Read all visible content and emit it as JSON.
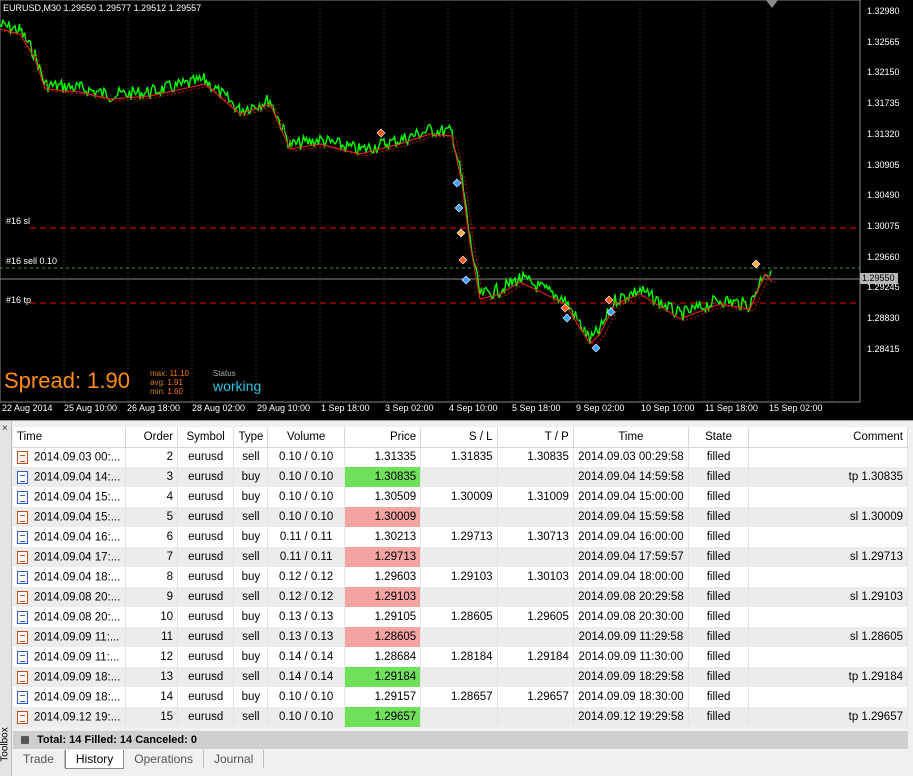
{
  "chart": {
    "title": "EURUSD,M30  1.29550 1.29577 1.29512 1.29557",
    "price_labels": [
      "1.32980",
      "1.32565",
      "1.32150",
      "1.31735",
      "1.31320",
      "1.30905",
      "1.30490",
      "1.30075",
      "1.29660",
      "1.29245",
      "1.28830",
      "1.28415"
    ],
    "current_price": "1.29550",
    "time_labels": [
      "22 Aug 2014",
      "25 Aug 10:00",
      "26 Aug 18:00",
      "28 Aug 02:00",
      "29 Aug 10:00",
      "1 Sep 18:00",
      "3 Sep 02:00",
      "4 Sep 10:00",
      "5 Sep 18:00",
      "9 Sep 02:00",
      "10 Sep 10:00",
      "11 Sep 18:00",
      "15 Sep 02:00"
    ],
    "lines": {
      "sl": "#16 sl",
      "sell": "#16 sell 0.10",
      "tp": "#16 tp"
    },
    "spread": "Spread: 1.90",
    "stats": {
      "max_label": "max:",
      "max": "11.10",
      "avg_label": "avg:",
      "avg": "1.91",
      "min_label": "min:",
      "min": "1.60"
    },
    "status_label": "Status",
    "status_value": "working",
    "colors": {
      "candles": "#00ff00",
      "ma": "#ff2020",
      "sl_line": "#ff0000",
      "tp_line": "#ff0000"
    }
  },
  "history": {
    "columns": [
      "Time",
      "Order",
      "Symbol",
      "Type",
      "Volume",
      "Price",
      "S / L",
      "T / P",
      "Time",
      "State",
      "Comment"
    ],
    "rows": [
      {
        "time": "2014.09.03 00:...",
        "order": "2",
        "symbol": "eurusd",
        "type": "sell",
        "volume": "0.10 / 0.10",
        "price": "1.31335",
        "sl": "1.31835",
        "tp": "1.30835",
        "time2": "2014.09.03 00:29:58",
        "state": "filled",
        "comment": "",
        "hl": ""
      },
      {
        "time": "2014.09.04 14:...",
        "order": "3",
        "symbol": "eurusd",
        "type": "buy",
        "volume": "0.10 / 0.10",
        "price": "1.30835",
        "sl": "",
        "tp": "",
        "time2": "2014.09.04 14:59:58",
        "state": "filled",
        "comment": "tp 1.30835",
        "hl": "green"
      },
      {
        "time": "2014.09.04 15:...",
        "order": "4",
        "symbol": "eurusd",
        "type": "buy",
        "volume": "0.10 / 0.10",
        "price": "1.30509",
        "sl": "1.30009",
        "tp": "1.31009",
        "time2": "2014.09.04 15:00:00",
        "state": "filled",
        "comment": "",
        "hl": ""
      },
      {
        "time": "2014.09.04 15:...",
        "order": "5",
        "symbol": "eurusd",
        "type": "sell",
        "volume": "0.10 / 0.10",
        "price": "1.30009",
        "sl": "",
        "tp": "",
        "time2": "2014.09.04 15:59:58",
        "state": "filled",
        "comment": "sl 1.30009",
        "hl": "red"
      },
      {
        "time": "2014.09.04 16:...",
        "order": "6",
        "symbol": "eurusd",
        "type": "buy",
        "volume": "0.11 / 0.11",
        "price": "1.30213",
        "sl": "1.29713",
        "tp": "1.30713",
        "time2": "2014.09.04 16:00:00",
        "state": "filled",
        "comment": "",
        "hl": ""
      },
      {
        "time": "2014.09.04 17:...",
        "order": "7",
        "symbol": "eurusd",
        "type": "sell",
        "volume": "0.11 / 0.11",
        "price": "1.29713",
        "sl": "",
        "tp": "",
        "time2": "2014.09.04 17:59:57",
        "state": "filled",
        "comment": "sl 1.29713",
        "hl": "red"
      },
      {
        "time": "2014.09.04 18:...",
        "order": "8",
        "symbol": "eurusd",
        "type": "buy",
        "volume": "0.12 / 0.12",
        "price": "1.29603",
        "sl": "1.29103",
        "tp": "1.30103",
        "time2": "2014.09.04 18:00:00",
        "state": "filled",
        "comment": "",
        "hl": ""
      },
      {
        "time": "2014.09.08 20:...",
        "order": "9",
        "symbol": "eurusd",
        "type": "sell",
        "volume": "0.12 / 0.12",
        "price": "1.29103",
        "sl": "",
        "tp": "",
        "time2": "2014.09.08 20:29:58",
        "state": "filled",
        "comment": "sl 1.29103",
        "hl": "red"
      },
      {
        "time": "2014.09.08 20:...",
        "order": "10",
        "symbol": "eurusd",
        "type": "buy",
        "volume": "0.13 / 0.13",
        "price": "1.29105",
        "sl": "1.28605",
        "tp": "1.29605",
        "time2": "2014.09.08 20:30:00",
        "state": "filled",
        "comment": "",
        "hl": ""
      },
      {
        "time": "2014.09.09 11:...",
        "order": "11",
        "symbol": "eurusd",
        "type": "sell",
        "volume": "0.13 / 0.13",
        "price": "1.28605",
        "sl": "",
        "tp": "",
        "time2": "2014.09.09 11:29:58",
        "state": "filled",
        "comment": "sl 1.28605",
        "hl": "red"
      },
      {
        "time": "2014.09.09 11:...",
        "order": "12",
        "symbol": "eurusd",
        "type": "buy",
        "volume": "0.14 / 0.14",
        "price": "1.28684",
        "sl": "1.28184",
        "tp": "1.29184",
        "time2": "2014.09.09 11:30:00",
        "state": "filled",
        "comment": "",
        "hl": ""
      },
      {
        "time": "2014.09.09 18:...",
        "order": "13",
        "symbol": "eurusd",
        "type": "sell",
        "volume": "0.14 / 0.14",
        "price": "1.29184",
        "sl": "",
        "tp": "",
        "time2": "2014.09.09 18:29:58",
        "state": "filled",
        "comment": "tp 1.29184",
        "hl": "green"
      },
      {
        "time": "2014.09.09 18:...",
        "order": "14",
        "symbol": "eurusd",
        "type": "buy",
        "volume": "0.10 / 0.10",
        "price": "1.29157",
        "sl": "1.28657",
        "tp": "1.29657",
        "time2": "2014.09.09 18:30:00",
        "state": "filled",
        "comment": "",
        "hl": ""
      },
      {
        "time": "2014.09.12 19:...",
        "order": "15",
        "symbol": "eurusd",
        "type": "sell",
        "volume": "0.10 / 0.10",
        "price": "1.29657",
        "sl": "",
        "tp": "",
        "time2": "2014.09.12 19:29:58",
        "state": "filled",
        "comment": "tp 1.29657",
        "hl": "green"
      }
    ],
    "summary": "Total: 14  Filled: 14  Canceled: 0"
  },
  "toolbox": {
    "label": "Toolbox",
    "close": "×",
    "tabs": [
      "Trade",
      "History",
      "Operations",
      "Journal"
    ],
    "active_tab": "History"
  }
}
